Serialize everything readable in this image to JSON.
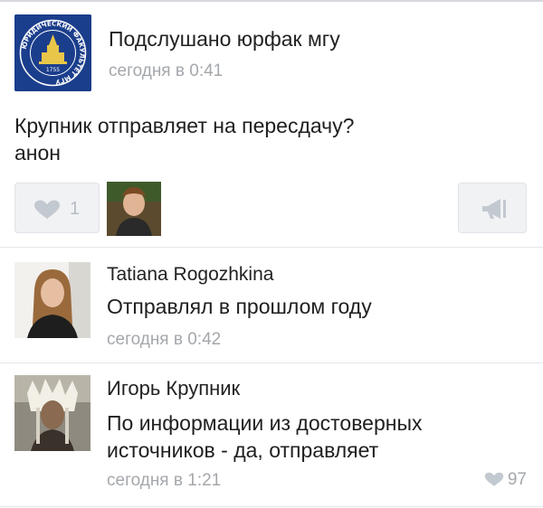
{
  "post": {
    "group_name": "Подслушано юрфак мгу",
    "time": "сегодня в 0:41",
    "text_lines": [
      "Крупник отправляет на пересдачу?",
      "анон"
    ],
    "likes": "1"
  },
  "logo": {
    "ring_text": "ЮРИДИЧЕСКИЙ ФАКУЛЬТЕТ МГУ",
    "year": "1755"
  },
  "comments": [
    {
      "author": "Tatiana Rogozhkina",
      "text_lines": [
        "Отправлял в прошлом году"
      ],
      "time": "сегодня в 0:42"
    },
    {
      "author": "Игорь Крупник",
      "text_lines": [
        "По информации из достоверных",
        "источников - да, отправляет"
      ],
      "time": "сегодня в 1:21",
      "likes": "97"
    }
  ],
  "colors": {
    "logo_blue": "#1b3e8c",
    "logo_gold": "#e8c64a",
    "muted": "#a4a7ab",
    "button_bg": "#f0f2f4"
  },
  "icons": {
    "like": "heart-icon",
    "share": "megaphone-icon"
  }
}
